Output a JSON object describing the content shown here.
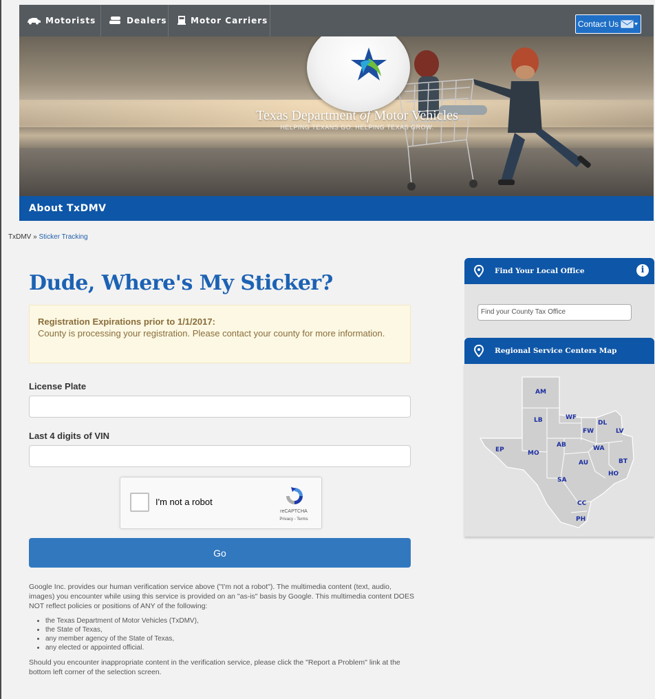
{
  "header": {
    "nav": [
      {
        "label": "Motorists",
        "icon": "car-icon"
      },
      {
        "label": "Dealers",
        "icon": "cars-icon"
      },
      {
        "label": "Motor Carriers",
        "icon": "truck-icon"
      }
    ],
    "contact_label": "Contact Us",
    "agency_name_1": "Texas Department ",
    "agency_name_of": "of",
    "agency_name_2": " Motor Vehicles",
    "tagline": "HELPING TEXANS GO. HELPING TEXAS GROW.",
    "section_title": "About TxDMV"
  },
  "breadcrumb": {
    "home": "TxDMV",
    "separator": "»",
    "current": "Sticker Tracking"
  },
  "main": {
    "title": "Dude, Where's My Sticker?",
    "alert": {
      "heading": "Registration Expirations prior to 1/1/2017:",
      "body": "County is processing your registration. Please contact your county for more information."
    },
    "license_label": "License Plate",
    "vin_label": "Last 4 digits of VIN",
    "captcha": {
      "label": "I'm not a robot",
      "brand": "reCAPTCHA",
      "links": "Privacy - Terms"
    },
    "go_label": "Go",
    "disclaimer_intro": "Google Inc. provides our human verification service above (\"I'm not a robot\"). The multimedia content (text, audio, images) you encounter while using this service is provided on an \"as-is\" basis by Google. This multimedia content DOES NOT reflect policies or positions of ANY of the following:",
    "disclaimer_list": [
      "the Texas Department of Motor Vehicles (TxDMV),",
      "the State of Texas,",
      "any member agency of the State of Texas,",
      "any elected or appointed official."
    ],
    "disclaimer_outro": "Should you encounter inappropriate content in the verification service, please click the \"Report a Problem\" link at the bottom left corner of the selection screen."
  },
  "sidebar": {
    "office_title": "Find Your Local Office",
    "office_placeholder": "Find your County Tax Office",
    "map_title": "Regional Service Centers Map",
    "regions": [
      "AM",
      "LB",
      "WF",
      "DL",
      "FW",
      "LV",
      "EP",
      "AB",
      "MO",
      "WA",
      "AU",
      "BT",
      "HO",
      "SA",
      "CC",
      "PH"
    ]
  },
  "colors": {
    "brand_blue": "#0e56a7",
    "title_blue": "#1c62b4",
    "button_blue": "#3278bf",
    "alert_bg": "#fcf8e3"
  }
}
